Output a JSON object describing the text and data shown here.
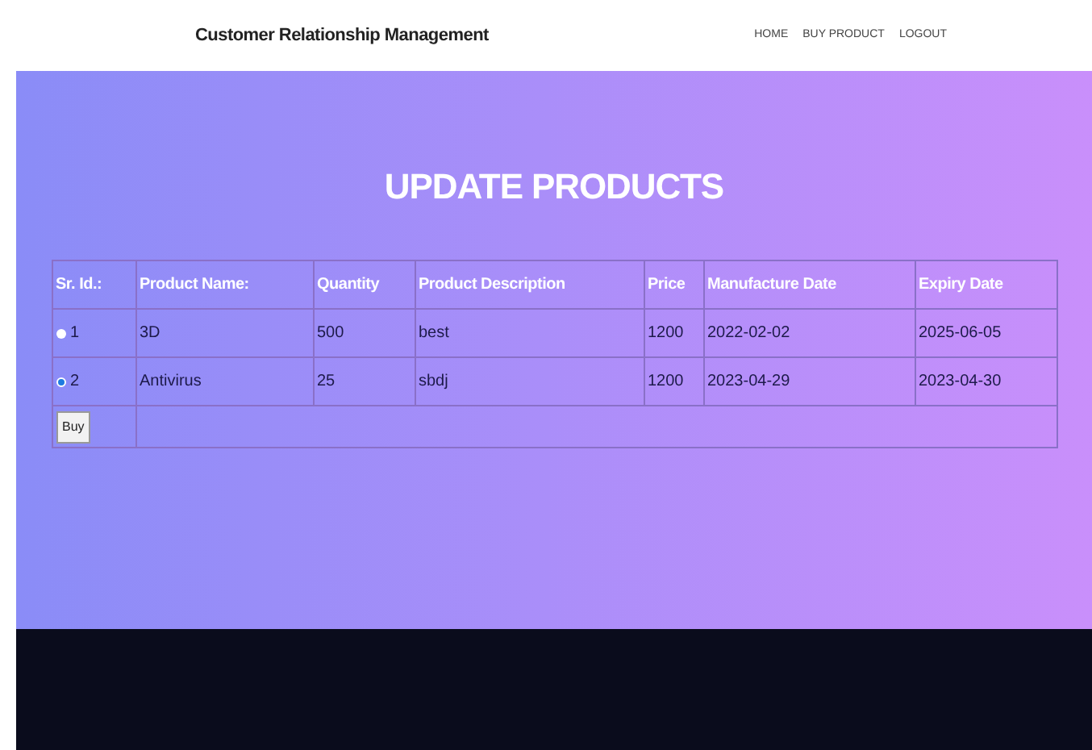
{
  "header": {
    "brand": "Customer Relationship Management",
    "nav": [
      "HOME",
      "BUY PRODUCT",
      "LOGOUT"
    ]
  },
  "title": "UPDATE PRODUCTS",
  "table": {
    "columns": [
      "Sr. Id.:",
      "Product Name:",
      "Quantity",
      "Product Description",
      "Price",
      "Manufacture Date",
      "Expiry Date"
    ],
    "rows": [
      {
        "selected": false,
        "cells": [
          "1",
          "3D",
          "500",
          "best",
          "1200",
          "2022-02-02",
          "2025-06-05"
        ]
      },
      {
        "selected": true,
        "cells": [
          "2",
          "Antivirus",
          "25",
          "sbdj",
          "1200",
          "2023-04-29",
          "2023-04-30"
        ]
      }
    ]
  },
  "button": "Buy"
}
